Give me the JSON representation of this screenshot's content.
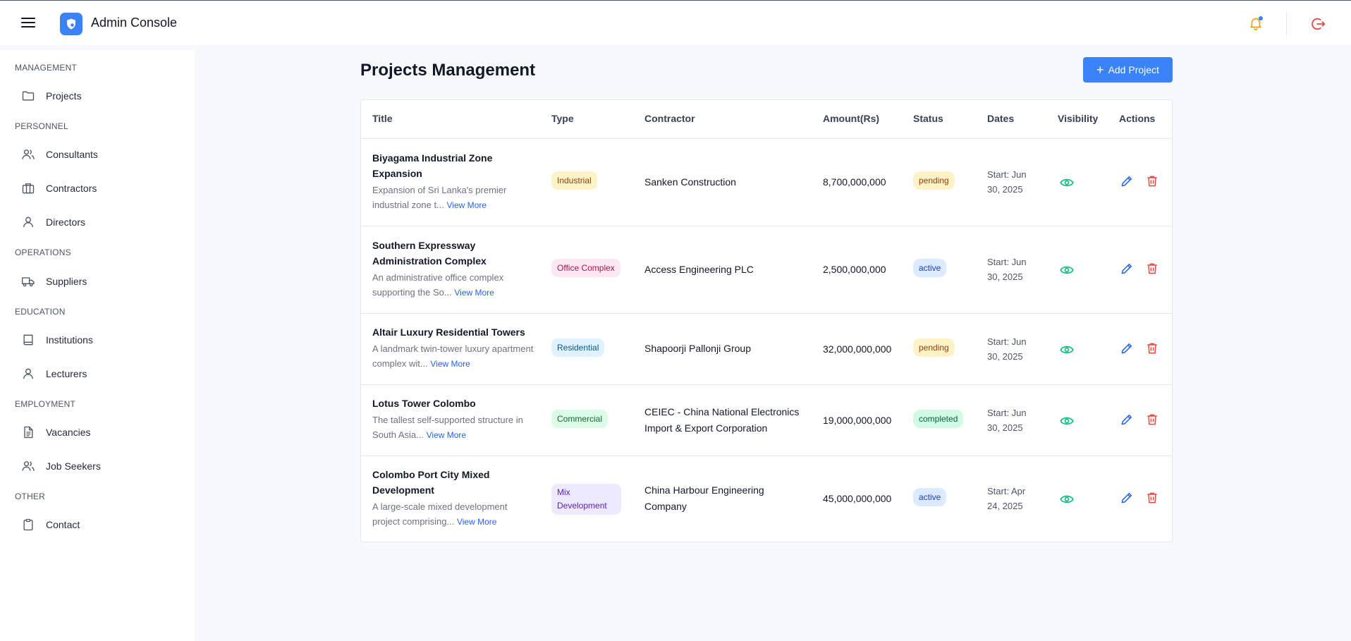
{
  "app": {
    "title": "Admin Console"
  },
  "header": {
    "bell_dot_color": "#3b82f6"
  },
  "sidebar": {
    "sections": [
      {
        "label": "MANAGEMENT"
      },
      {
        "label": "PERSONNEL"
      },
      {
        "label": "OPERATIONS"
      },
      {
        "label": "EDUCATION"
      },
      {
        "label": "EMPLOYMENT"
      },
      {
        "label": "OTHER"
      }
    ],
    "items": [
      {
        "label": "Projects",
        "icon": "folder-icon"
      },
      {
        "label": "Consultants",
        "icon": "users-icon"
      },
      {
        "label": "Contractors",
        "icon": "briefcase-icon"
      },
      {
        "label": "Directors",
        "icon": "user-icon"
      },
      {
        "label": "Suppliers",
        "icon": "truck-icon"
      },
      {
        "label": "Institutions",
        "icon": "book-icon"
      },
      {
        "label": "Lecturers",
        "icon": "user-icon"
      },
      {
        "label": "Vacancies",
        "icon": "document-icon"
      },
      {
        "label": "Job Seekers",
        "icon": "users-icon"
      },
      {
        "label": "Contact",
        "icon": "clipboard-icon"
      }
    ]
  },
  "main": {
    "title": "Projects Management",
    "add_button": "Add Project",
    "columns": [
      "Title",
      "Type",
      "Contractor",
      "Amount(Rs)",
      "Status",
      "Dates",
      "Visibility",
      "Actions"
    ],
    "view_more": "View More",
    "rows": [
      {
        "title": "Biyagama Industrial Zone Expansion",
        "desc": "Expansion of Sri Lanka's premier industrial zone t...",
        "type": "Industrial",
        "contractor": "Sanken Construction",
        "amount": "8,700,000,000",
        "status": "pending",
        "date": "Start: Jun 30, 2025"
      },
      {
        "title": "Southern Expressway Administration Complex",
        "desc": "An administrative office complex supporting the So...",
        "type": "Office Complex",
        "contractor": "Access Engineering PLC",
        "amount": "2,500,000,000",
        "status": "active",
        "date": "Start: Jun 30, 2025"
      },
      {
        "title": "Altair Luxury Residential Towers",
        "desc": "A landmark twin-tower luxury apartment complex wit...",
        "type": "Residential",
        "contractor": "Shapoorji Pallonji Group",
        "amount": "32,000,000,000",
        "status": "pending",
        "date": "Start: Jun 30, 2025"
      },
      {
        "title": "Lotus Tower Colombo",
        "desc": "The tallest self-supported structure in South Asia...",
        "type": "Commercial",
        "contractor": "CEIEC - China National Electronics Import & Export Corporation",
        "amount": "19,000,000,000",
        "status": "completed",
        "date": "Start: Jun 30, 2025"
      },
      {
        "title": "Colombo Port City Mixed Development",
        "desc": "A large-scale mixed development project comprising...",
        "type": "Mix Development",
        "contractor": "China Harbour Engineering Company",
        "amount": "45,000,000,000",
        "status": "active",
        "date": "Start: Apr 24, 2025"
      }
    ]
  },
  "colors": {
    "accent": "#3b82f6",
    "visibility": "#10b981",
    "edit": "#2563eb",
    "delete": "#ef4444"
  }
}
